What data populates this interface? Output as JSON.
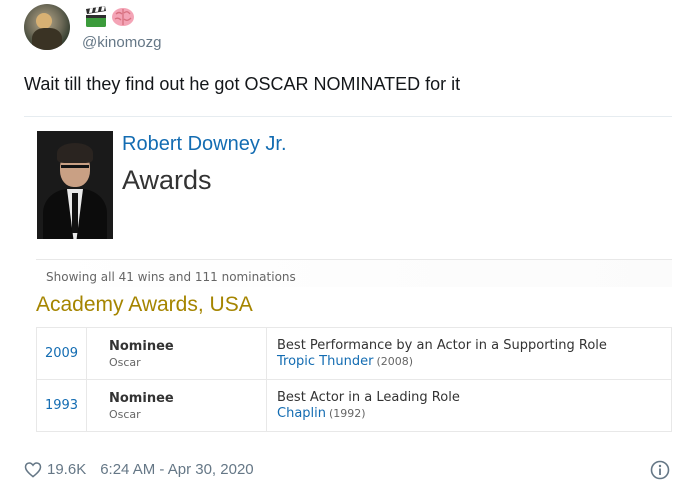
{
  "tweet": {
    "handle": "@kinomozg",
    "name_emojis": [
      "clapper-board-icon",
      "brain-icon"
    ],
    "text": "Wait till they find out he got OSCAR NOMINATED for it",
    "likes": "19.6K",
    "timestamp": "6:24 AM - Apr 30, 2020"
  },
  "imdb": {
    "actor": "Robert Downey Jr.",
    "page_title": "Awards",
    "summary": "Showing all 41 wins and 111 nominations",
    "event": "Academy Awards, USA",
    "rows": [
      {
        "year": "2009",
        "outcome": "Nominee",
        "award": "Oscar",
        "category": "Best Performance by an Actor in a Supporting Role",
        "film": "Tropic Thunder",
        "film_year": "(2008)"
      },
      {
        "year": "1993",
        "outcome": "Nominee",
        "award": "Oscar",
        "category": "Best Actor in a Leading Role",
        "film": "Chaplin",
        "film_year": "(1992)"
      }
    ]
  },
  "colors": {
    "link_blue": "#136cb2",
    "event_gold": "#a58500",
    "muted": "#657786"
  }
}
